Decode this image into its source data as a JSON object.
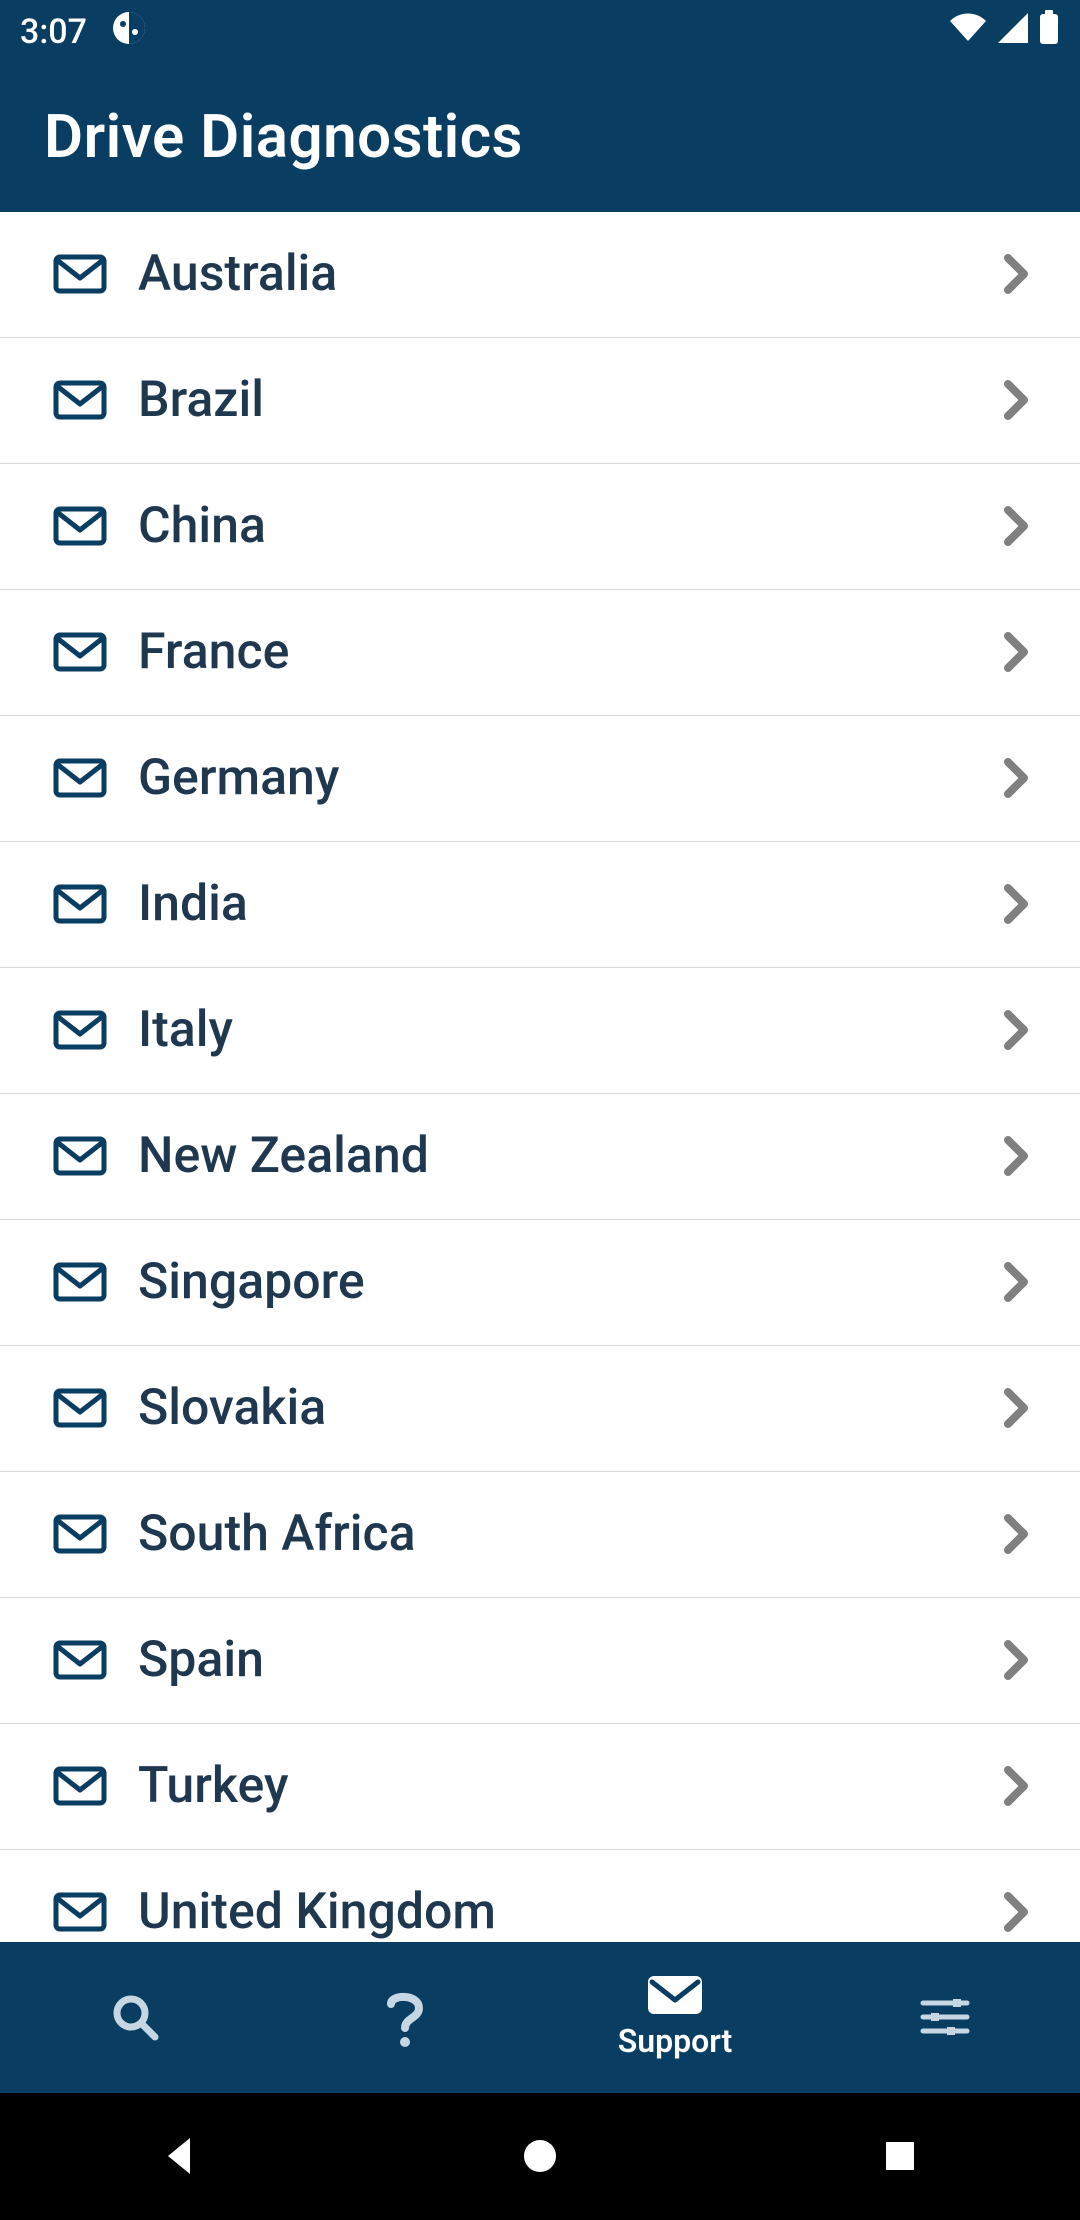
{
  "status": {
    "time": "3:07"
  },
  "header": {
    "title": "Drive Diagnostics"
  },
  "countries": [
    {
      "name": "Australia"
    },
    {
      "name": "Brazil"
    },
    {
      "name": "China"
    },
    {
      "name": "France"
    },
    {
      "name": "Germany"
    },
    {
      "name": "India"
    },
    {
      "name": "Italy"
    },
    {
      "name": "New Zealand"
    },
    {
      "name": "Singapore"
    },
    {
      "name": "Slovakia"
    },
    {
      "name": "South Africa"
    },
    {
      "name": "Spain"
    },
    {
      "name": "Turkey"
    },
    {
      "name": "United Kingdom"
    }
  ],
  "nav": {
    "support_label": "Support",
    "active_index": 2
  },
  "colors": {
    "accent": "#0a3d62"
  }
}
